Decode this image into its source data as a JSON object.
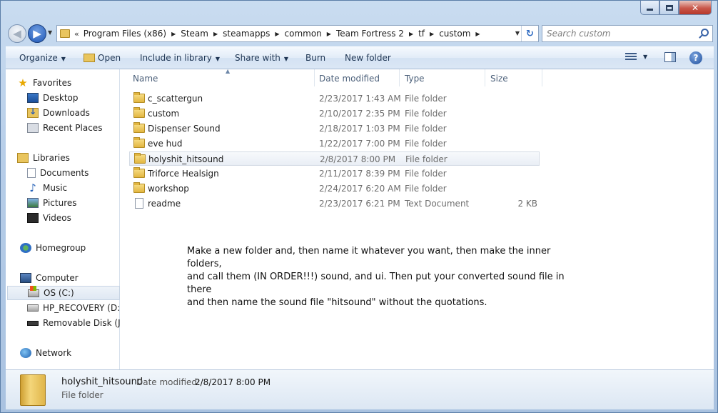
{
  "nav": {
    "back_glyph": "◀",
    "forward_glyph": "▶",
    "refresh_glyph": "↻",
    "address_prefix": "«",
    "breadcrumbs": [
      "Program Files (x86)",
      "Steam",
      "steamapps",
      "common",
      "Team Fortress 2",
      "tf",
      "custom"
    ],
    "search_placeholder": "Search custom"
  },
  "toolbar": {
    "organize": "Organize",
    "open": "Open",
    "include_in_library": "Include in library",
    "share_with": "Share with",
    "burn": "Burn",
    "new_folder": "New folder",
    "help": "?"
  },
  "sidebar": {
    "favorites": "Favorites",
    "desktop": "Desktop",
    "downloads": "Downloads",
    "recent_places": "Recent Places",
    "libraries": "Libraries",
    "documents": "Documents",
    "music": "Music",
    "pictures": "Pictures",
    "videos": "Videos",
    "homegroup": "Homegroup",
    "computer": "Computer",
    "os_c": "OS (C:)",
    "hp_recovery": "HP_RECOVERY (D:)",
    "removable_disk": "Removable Disk (J:)",
    "network": "Network"
  },
  "columns": {
    "name": "Name",
    "date_modified": "Date modified",
    "type": "Type",
    "size": "Size"
  },
  "files": [
    {
      "name": "c_scattergun",
      "date": "2/23/2017 1:43 AM",
      "type": "File folder",
      "size": "",
      "kind": "folder"
    },
    {
      "name": "custom",
      "date": "2/10/2017 2:35 PM",
      "type": "File folder",
      "size": "",
      "kind": "folder"
    },
    {
      "name": "Dispenser Sound",
      "date": "2/18/2017 1:03 PM",
      "type": "File folder",
      "size": "",
      "kind": "folder"
    },
    {
      "name": "eve hud",
      "date": "1/22/2017 7:00 PM",
      "type": "File folder",
      "size": "",
      "kind": "folder"
    },
    {
      "name": "holyshit_hitsound",
      "date": "2/8/2017 8:00 PM",
      "type": "File folder",
      "size": "",
      "kind": "folder",
      "selected": true
    },
    {
      "name": "Triforce Healsign",
      "date": "2/11/2017 8:39 PM",
      "type": "File folder",
      "size": "",
      "kind": "folder"
    },
    {
      "name": "workshop",
      "date": "2/24/2017 6:20 AM",
      "type": "File folder",
      "size": "",
      "kind": "folder"
    },
    {
      "name": "readme",
      "date": "2/23/2017 6:21 PM",
      "type": "Text Document",
      "size": "2 KB",
      "kind": "text"
    }
  ],
  "note": {
    "line1": "Make a new folder and, then name it whatever you want, then make the inner folders,",
    "line2": "and call them (IN ORDER!!!) sound, and ui. Then put your converted sound file in there",
    "line3": "and then name the sound file \"hitsound\" without the quotations."
  },
  "details": {
    "name": "holyshit_hitsound",
    "modified_label": "Date modified:",
    "modified_value": "2/8/2017 8:00 PM",
    "type": "File folder"
  }
}
